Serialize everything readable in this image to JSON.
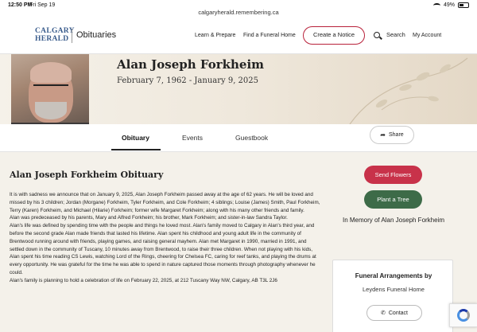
{
  "status_bar": {
    "time": "12:50 PM",
    "date": "Fri Sep 19",
    "url": "calgaryherald.remembering.ca",
    "battery": "49%",
    "battery_level": 0.49
  },
  "header": {
    "logo_line1": "CALGARY",
    "logo_line2": "HERALD",
    "section": "Obituaries",
    "nav": [
      "Learn & Prepare",
      "Find a Funeral Home"
    ],
    "create_notice": "Create a Notice",
    "search": "Search",
    "account": "My Account"
  },
  "profile": {
    "name": "Alan Joseph Forkheim",
    "dates": "February 7, 1962 - January 9, 2025"
  },
  "tabs": [
    "Obituary",
    "Events",
    "Guestbook"
  ],
  "share": "Share",
  "obituary": {
    "title": "Alan Joseph Forkheim Obituary",
    "paragraphs": [
      "It is with sadness we announce that on January 9, 2025, Alan Joseph Forkheim passed away at the age of 62 years. He will be loved and missed by his 3 children; Jordan (Morgane) Forkheim, Tyler Forkheim, and Cole Forkheim; 4 siblings; Louise (James) Smith, Paul Forkheim, Terry (Karen) Forkheim, and Michael (Hilarie) Forkheim; former wife Margaret Forkheim; along with his many other friends and family.",
      "Alan was predeceased by his parents, Mary and Alfred Forkheim; his brother, Mark Forkheim; and sister-in-law Sandra Taylor.",
      "Alan's life was defined by spending time with the people and things he loved most. Alan's family moved to Calgary in Alan's third year, and before the second grade Alan made friends that lasted his lifetime. Alan spent his childhood and young adult life in the community of Brentwood running around with friends, playing games, and raising general mayhem. Alan met Margaret in 1990, married in 1991, and settled down in the community of Tuscany, 10 minutes away from Brentwood, to raise their three children. When not playing with his kids, Alan spent his time reading CS Lewis, watching Lord of the Rings, cheering for Chelsea FC, caring for reef tanks, and playing the drums at every opportunity. He was grateful for the time he was able to spend in nature captured those moments through photography whenever he could.",
      "Alan's family is planning to hold a celebration of life on February 22, 2025, at 212 Tuscany Way NW, Calgary, AB T3L 2J6"
    ]
  },
  "sidebar": {
    "send_flowers": "Send Flowers",
    "plant_tree": "Plant a Tree",
    "memory": "In Memory of Alan Joseph Forkheim",
    "arrangements_title": "Funeral Arrangements by",
    "funeral_home": "Leydens Funeral Home",
    "contact": "Contact"
  },
  "colors": {
    "accent_red": "#c8324a",
    "tree_green": "#3d6b48",
    "logo_blue": "#3a5c8c"
  }
}
